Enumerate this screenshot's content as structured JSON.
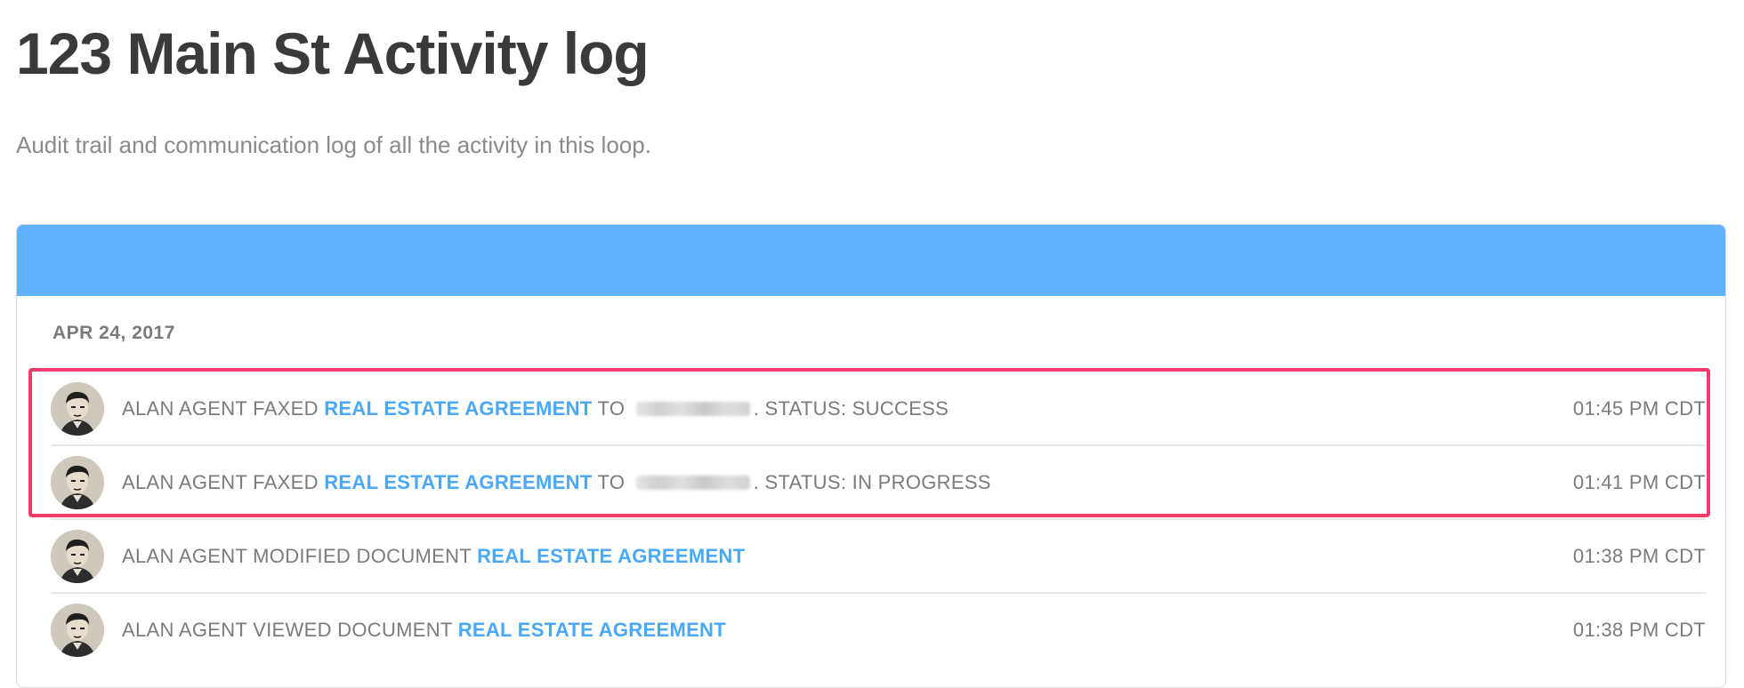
{
  "page": {
    "title": "123 Main St Activity log",
    "subtitle": "Audit trail and communication log of all the activity in this loop."
  },
  "log": {
    "date": "APR 24, 2017",
    "rows": [
      {
        "prefix": "ALAN AGENT FAXED ",
        "document": "REAL ESTATE AGREEMENT",
        "middle": " TO ",
        "suffix": ". STATUS: SUCCESS",
        "time": "01:45 PM CDT"
      },
      {
        "prefix": "ALAN AGENT FAXED ",
        "document": "REAL ESTATE AGREEMENT",
        "middle": " TO ",
        "suffix": ". STATUS: IN PROGRESS",
        "time": "01:41 PM CDT"
      },
      {
        "prefix": "ALAN AGENT MODIFIED DOCUMENT ",
        "document": "REAL ESTATE AGREEMENT",
        "time": "01:38 PM CDT"
      },
      {
        "prefix": "ALAN AGENT VIEWED DOCUMENT ",
        "document": "REAL ESTATE AGREEMENT",
        "time": "01:38 PM CDT"
      }
    ]
  },
  "colors": {
    "header_bar": "#5fb3fd",
    "link": "#4aa8f7",
    "highlight": "#f23a6d"
  },
  "icons": {
    "avatar": "user-avatar-icon"
  }
}
